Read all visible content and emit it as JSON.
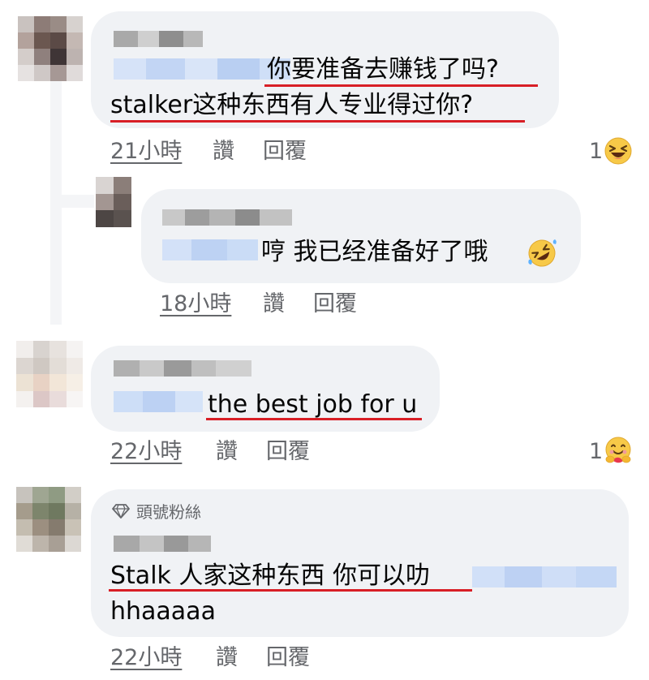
{
  "comments": [
    {
      "text_line1": "你要准备去赚钱了吗?",
      "text_line2": "stalker这种东西有人专业得过你?",
      "time": "21小時",
      "like_label": "讚",
      "reply_label": "回覆",
      "reaction_count": "1",
      "reaction_icon": "laughing-squint-emoji"
    },
    {
      "text_line1": "哼 我已经准备好了哦",
      "text_emoji": "rolling-on-floor-laughing-emoji",
      "time": "18小時",
      "like_label": "讚",
      "reply_label": "回覆"
    },
    {
      "text_line1": "the best job for u",
      "time": "22小時",
      "like_label": "讚",
      "reply_label": "回覆",
      "reaction_count": "1",
      "reaction_icon": "hug-emoji"
    },
    {
      "badge": "頭號粉絲",
      "badge_icon": "diamond-icon",
      "text_line1": "Stalk 人家这种东西 你可以叻",
      "text_line2": "hhaaaaa",
      "time": "22小時",
      "like_label": "讚",
      "reply_label": "回覆"
    }
  ],
  "colors": {
    "bubble": "#f0f2f5",
    "meta_text": "#65676b",
    "underline": "#d81f26",
    "mention_blur": "#c6d8f5"
  }
}
